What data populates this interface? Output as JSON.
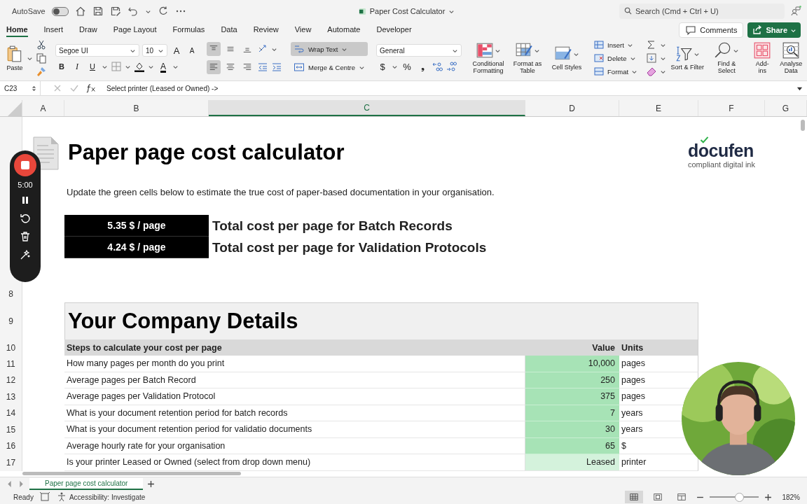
{
  "title_bar": {
    "autosave_label": "AutoSave",
    "autosave_on": false,
    "document_title": "Paper Cost Calculator",
    "search_placeholder": "Search (Cmd + Ctrl + U)"
  },
  "ribbon_tabs": [
    {
      "label": "Home",
      "selected": true
    },
    {
      "label": "Insert",
      "selected": false
    },
    {
      "label": "Draw",
      "selected": false
    },
    {
      "label": "Page Layout",
      "selected": false
    },
    {
      "label": "Formulas",
      "selected": false
    },
    {
      "label": "Data",
      "selected": false
    },
    {
      "label": "Review",
      "selected": false
    },
    {
      "label": "View",
      "selected": false
    },
    {
      "label": "Automate",
      "selected": false
    },
    {
      "label": "Developer",
      "selected": false
    }
  ],
  "comments_button": "Comments",
  "share_button": "Share",
  "ribbon": {
    "paste_label": "Paste",
    "font_name": "Segoe UI",
    "font_size": "10",
    "grow_font": "A",
    "shrink_font": "A",
    "format_buttons": [
      {
        "kind": "bold",
        "label": "B"
      },
      {
        "kind": "italic",
        "label": "I"
      },
      {
        "kind": "underline",
        "label": "U"
      }
    ],
    "font_color_label": "A",
    "vertical_align": [
      {
        "kind": "top",
        "selected": true
      },
      {
        "kind": "middle",
        "selected": false
      },
      {
        "kind": "bottom",
        "selected": false
      }
    ],
    "horizontal_align": [
      {
        "kind": "left",
        "selected": true
      },
      {
        "kind": "center",
        "selected": false
      },
      {
        "kind": "right",
        "selected": false
      }
    ],
    "wrap_text": {
      "label": "Wrap Text",
      "selected": true
    },
    "merge_label": "Merge & Centre",
    "number_format": "General",
    "currency_label": "$",
    "percent_label": "%",
    "comma_label": "❟",
    "large_buttons": [
      {
        "kind": "conditional",
        "label": "Conditional Formatting"
      },
      {
        "kind": "table",
        "label": "Format as Table"
      },
      {
        "kind": "styles",
        "label": "Cell Styles"
      }
    ],
    "cell_buttons": [
      {
        "kind": "insert",
        "label": "Insert"
      },
      {
        "kind": "delete",
        "label": "Delete"
      },
      {
        "kind": "format",
        "label": "Format"
      }
    ],
    "edit_buttons": [
      {
        "kind": "sort",
        "label": "Sort & Filter"
      },
      {
        "kind": "find",
        "label": "Find & Select"
      }
    ],
    "extra_buttons": [
      {
        "kind": "addins",
        "label": "Add-ins"
      },
      {
        "kind": "analyse",
        "label": "Analyse Data"
      }
    ]
  },
  "formula_bar": {
    "name_box": "C23",
    "formula": "Select printer (Leased or Owned) ->"
  },
  "columns": [
    {
      "label": "A",
      "selected": false
    },
    {
      "label": "B",
      "selected": false
    },
    {
      "label": "C",
      "selected": true
    },
    {
      "label": "D",
      "selected": false
    },
    {
      "label": "E",
      "selected": false
    },
    {
      "label": "F",
      "selected": false
    },
    {
      "label": "G",
      "selected": false
    }
  ],
  "sheet": {
    "title": "Paper page cost calculator",
    "logo_name": "docufen",
    "logo_tagline": "compliant digital ink",
    "intro": "Update the green cells below to estimate the true cost of paper-based documentation in your organisation.",
    "costs": [
      {
        "value": "5.35 $ / page",
        "label": "Total cost per page for Batch Records"
      },
      {
        "value": "4.24 $ / page",
        "label": "Total cost per page for Validation Protocols"
      }
    ],
    "top_row_number": "8",
    "details_row_number": "9",
    "details_title": "Your Company Details",
    "header": {
      "number": "10",
      "step": "Steps to calculate your cost per page",
      "value": "Value",
      "units": "Units"
    },
    "rows": [
      {
        "number": "11",
        "step": "How many pages per month do you print",
        "value": "10,000",
        "units": "pages",
        "kind": "number"
      },
      {
        "number": "12",
        "step": "Average pages per Batch Record",
        "value": "250",
        "units": "pages",
        "kind": "number"
      },
      {
        "number": "13",
        "step": "Average pages per Validation Protocol",
        "value": "375",
        "units": "pages",
        "kind": "number"
      },
      {
        "number": "14",
        "step": "What is your document retention period for batch records",
        "value": "7",
        "units": "years",
        "kind": "number"
      },
      {
        "number": "15",
        "step": "What is your document retention period for validatio documents",
        "value": "30",
        "units": "years",
        "kind": "number"
      },
      {
        "number": "16",
        "step": "Average hourly rate for your organisation",
        "value": "65",
        "units": "$",
        "kind": "number"
      },
      {
        "number": "17",
        "step": "Is your printer Leased or Owned (select from drop down menu)",
        "value": "Leased",
        "units": "printer",
        "kind": "dropdown"
      }
    ]
  },
  "recorder": {
    "timer": "5:00"
  },
  "sheet_tabs": [
    {
      "label": "Paper page cost calculator",
      "selected": true
    }
  ],
  "status_bar": {
    "status": "Ready",
    "accessibility": "Accessibility: Investigate",
    "zoom": "182%",
    "zoom_slider": {
      "level": 0.6
    }
  }
}
